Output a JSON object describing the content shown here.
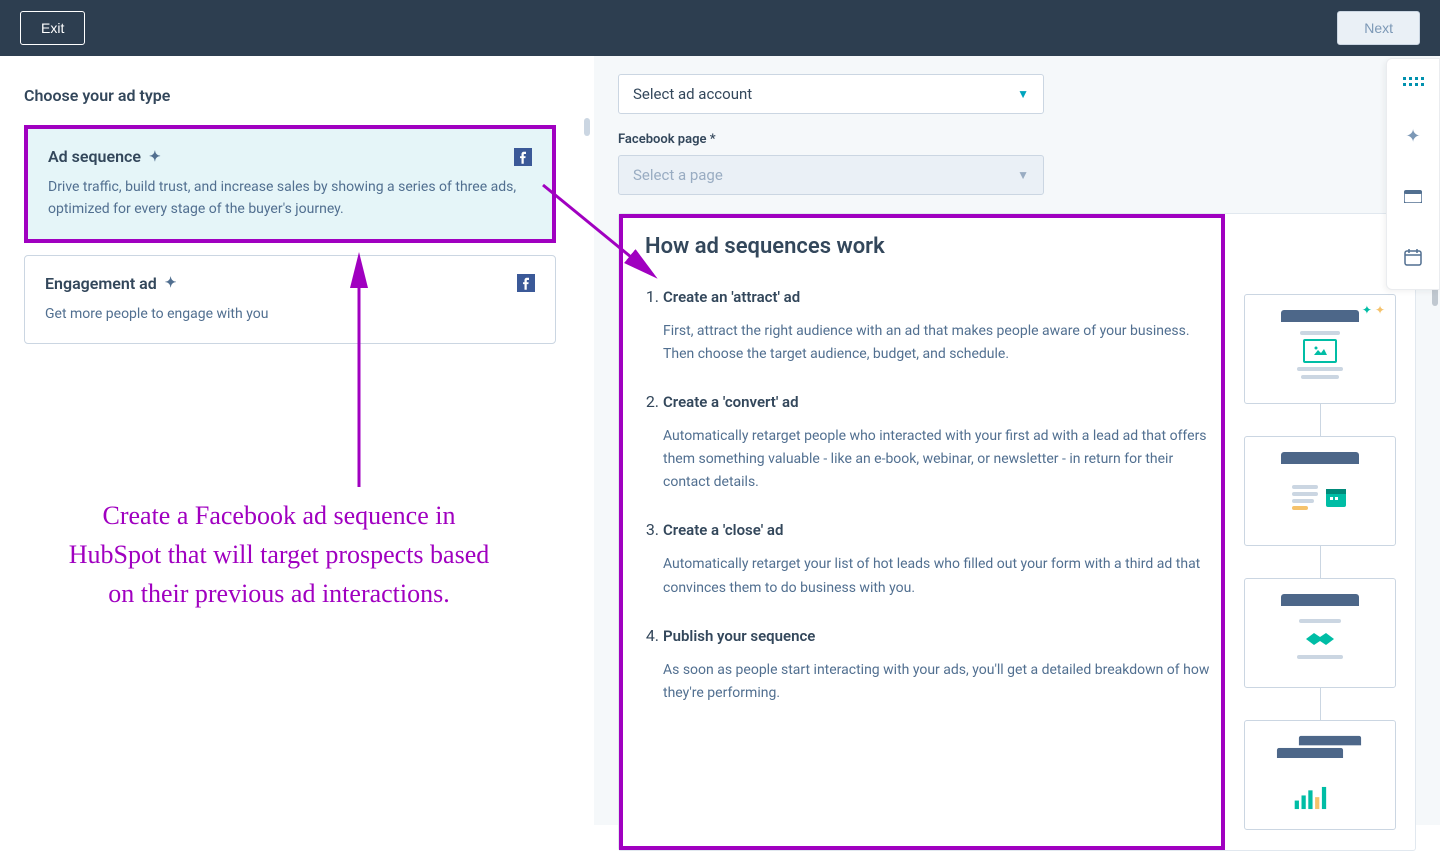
{
  "header": {
    "exit_label": "Exit",
    "next_label": "Next"
  },
  "left": {
    "title": "Choose your ad type",
    "cards": [
      {
        "title": "Ad sequence",
        "desc": "Drive traffic, build trust, and increase sales by showing a series of three ads, optimized for every stage of the buyer's journey."
      },
      {
        "title": "Engagement ad",
        "desc": "Get more people to engage with you"
      }
    ]
  },
  "right": {
    "account_placeholder": "Select ad account",
    "page_label": "Facebook page *",
    "page_placeholder": "Select a page",
    "info_title": "How ad sequences work",
    "steps": [
      {
        "title": "Create an 'attract' ad",
        "desc": "First, attract the right audience with an ad that makes people aware of your business. Then choose the target audience, budget, and schedule."
      },
      {
        "title": "Create a 'convert' ad",
        "desc": "Automatically retarget people who interacted with your first ad with a lead ad that offers them something valuable - like an e-book, webinar, or newsletter - in return for their contact details."
      },
      {
        "title": "Create a 'close' ad",
        "desc": "Automatically retarget your list of hot leads who filled out your form with a third ad that convinces them to do business with you."
      },
      {
        "title": "Publish your sequence",
        "desc": "As soon as people start interacting with your ads, you'll get a detailed breakdown of how they're performing."
      }
    ]
  },
  "annotation": {
    "text": "Create a Facebook ad sequence in HubSpot that will target prospects based on their previous ad interactions."
  }
}
